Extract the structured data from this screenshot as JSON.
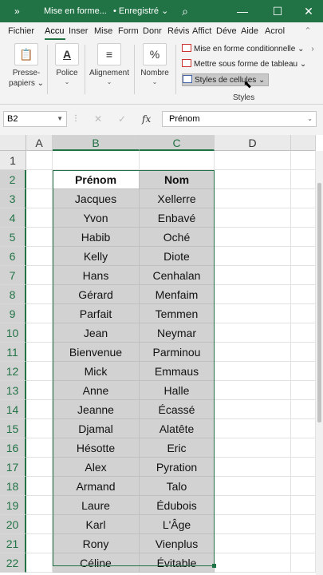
{
  "titlebar": {
    "chevron": "»",
    "title": "Mise en forme...",
    "status": "• Enregistré ⌄",
    "icons": {
      "search": "⌕",
      "minimize": "—",
      "maximize": "☐",
      "close": "✕"
    }
  },
  "tabs": [
    "Fichier",
    "Accu",
    "Inser",
    "Mise",
    "Form",
    "Donr",
    "Révis",
    "Affict",
    "Déve",
    "Aide",
    "Acrol"
  ],
  "ribbon": {
    "groups": [
      {
        "label": "Presse-papiers",
        "label1": "Presse-",
        "label2": "papiers ⌄",
        "icon": "clipboard-icon",
        "glyph": "📋"
      },
      {
        "label": "Police",
        "icon": "font-color-icon",
        "glyph": "A"
      },
      {
        "label": "Alignement",
        "icon": "align-icon",
        "glyph": "≡"
      },
      {
        "label": "Nombre",
        "icon": "percent-icon",
        "glyph": "%"
      }
    ],
    "styles": {
      "items": [
        "Mise en forme conditionnelle ⌄",
        "Mettre sous forme de tableau ⌄",
        "Styles de cellules ⌄"
      ],
      "group_label": "Styles"
    }
  },
  "formula_bar": {
    "name_box": "B2",
    "fx": "fx",
    "cancel": "✕",
    "enter": "✓",
    "formula": "Prénom"
  },
  "grid": {
    "columns": [
      "A",
      "B",
      "C",
      "D"
    ],
    "header_row": {
      "B": "Prénom",
      "C": "Nom"
    },
    "rows": [
      {
        "num": "1",
        "B": "",
        "C": ""
      },
      {
        "num": "2",
        "B": "Prénom",
        "C": "Nom"
      },
      {
        "num": "3",
        "B": "Jacques",
        "C": "Xellerre"
      },
      {
        "num": "4",
        "B": "Yvon",
        "C": "Enbavé"
      },
      {
        "num": "5",
        "B": "Habib",
        "C": "Oché"
      },
      {
        "num": "6",
        "B": "Kelly",
        "C": "Diote"
      },
      {
        "num": "7",
        "B": "Hans",
        "C": "Cenhalan"
      },
      {
        "num": "8",
        "B": "Gérard",
        "C": "Menfaim"
      },
      {
        "num": "9",
        "B": "Parfait",
        "C": "Temmen"
      },
      {
        "num": "10",
        "B": "Jean",
        "C": "Neymar"
      },
      {
        "num": "11",
        "B": "Bienvenue",
        "C": "Parminou"
      },
      {
        "num": "12",
        "B": "Mick",
        "C": "Emmaus"
      },
      {
        "num": "13",
        "B": "Anne",
        "C": "Halle"
      },
      {
        "num": "14",
        "B": "Jeanne",
        "C": "Écassé"
      },
      {
        "num": "15",
        "B": "Djamal",
        "C": "Alatête"
      },
      {
        "num": "16",
        "B": "Hésotte",
        "C": "Eric"
      },
      {
        "num": "17",
        "B": "Alex",
        "C": "Pyration"
      },
      {
        "num": "18",
        "B": "Armand",
        "C": "Talo"
      },
      {
        "num": "19",
        "B": "Laure",
        "C": "Édubois"
      },
      {
        "num": "20",
        "B": "Karl",
        "C": "L'Âge"
      },
      {
        "num": "21",
        "B": "Rony",
        "C": "Vienplus"
      },
      {
        "num": "22",
        "B": "Céline",
        "C": "Évitable"
      }
    ]
  },
  "colors": {
    "excel_green": "#217346",
    "selection_fill": "#d2d2d2"
  }
}
